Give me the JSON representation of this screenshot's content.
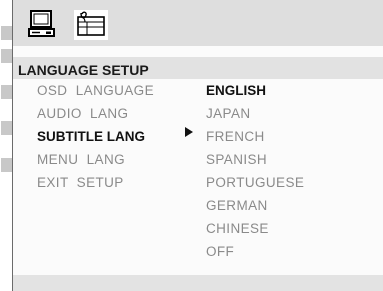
{
  "title": "LANGUAGE  SETUP",
  "icons": [
    "computer-icon",
    "language-setup-icon",
    "pointer-triangle-icon"
  ],
  "menu": {
    "items": [
      {
        "label": "OSD  LANGUAGE",
        "active": false
      },
      {
        "label": "AUDIO  LANG",
        "active": false
      },
      {
        "label": "SUBTITLE LANG",
        "active": true
      },
      {
        "label": "MENU  LANG",
        "active": false
      },
      {
        "label": "EXIT  SETUP",
        "active": false
      }
    ]
  },
  "options": {
    "items": [
      {
        "label": "ENGLISH",
        "active": true
      },
      {
        "label": "JAPAN",
        "active": false
      },
      {
        "label": "FRENCH",
        "active": false
      },
      {
        "label": "SPANISH",
        "active": false
      },
      {
        "label": "PORTUGUESE",
        "active": false
      },
      {
        "label": "GERMAN",
        "active": false
      },
      {
        "label": "CHINESE",
        "active": false
      },
      {
        "label": "OFF",
        "active": false
      }
    ]
  },
  "colors": {
    "active_text": "#111111",
    "inactive_text": "#8a8a8a",
    "bar_background": "#dedede",
    "screen_background": "#fbfbfb"
  }
}
